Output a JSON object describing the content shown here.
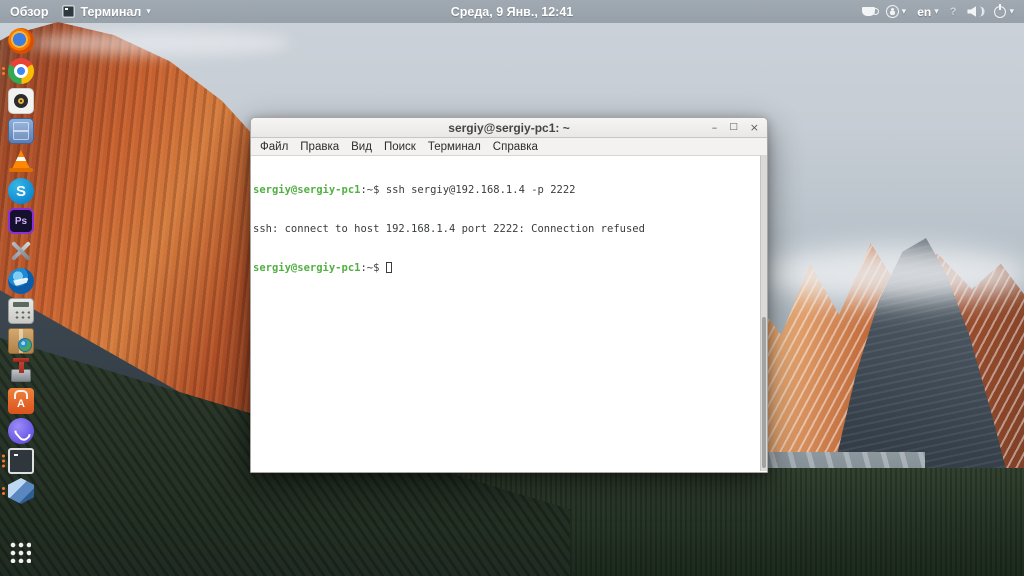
{
  "panel": {
    "activities_label": "Обзор",
    "app_menu_label": "Терминал",
    "clock": "Среда, 9 Янв., 12:41",
    "keyboard_layout": "en",
    "question_indicator": "?",
    "tray_icons": [
      "caffeine-cup-icon",
      "accessibility-icon",
      "keyboard-layout",
      "question-icon",
      "volume-icon",
      "power-icon"
    ]
  },
  "launcher": {
    "items": [
      {
        "name": "firefox",
        "dots": 0
      },
      {
        "name": "chrome",
        "dots": 2
      },
      {
        "name": "camera-app",
        "dots": 0
      },
      {
        "name": "file-cabinet",
        "dots": 0
      },
      {
        "name": "vlc",
        "dots": 0
      },
      {
        "name": "skype",
        "dots": 0
      },
      {
        "name": "photoshop",
        "dots": 0
      },
      {
        "name": "system-tools",
        "dots": 0
      },
      {
        "name": "thunderbird",
        "dots": 0
      },
      {
        "name": "calculator",
        "dots": 0
      },
      {
        "name": "package",
        "dots": 0
      },
      {
        "name": "archive-manager",
        "dots": 0
      },
      {
        "name": "software-center",
        "dots": 0
      },
      {
        "name": "viber",
        "dots": 0
      },
      {
        "name": "terminal",
        "dots": 3
      },
      {
        "name": "virtualbox",
        "dots": 2
      }
    ]
  },
  "window": {
    "title": "sergiy@sergiy-pc1: ~",
    "controls": {
      "minimize": "–",
      "maximize": "□",
      "close": "×"
    },
    "menu": [
      "Файл",
      "Правка",
      "Вид",
      "Поиск",
      "Терминал",
      "Справка"
    ],
    "terminal": {
      "prompt": "sergiy@sergiy-pc1",
      "prompt_suffix": ":~$",
      "command": "ssh sergiy@192.168.1.4 -p 2222",
      "output": "ssh: connect to host 192.168.1.4 port 2222: Connection refused"
    }
  },
  "colors": {
    "prompt_green": "#52b043",
    "terminal_foreground": "#3a3d3e",
    "terminal_background": "#ffffff",
    "running_dot_orange": "#f47a2a"
  }
}
